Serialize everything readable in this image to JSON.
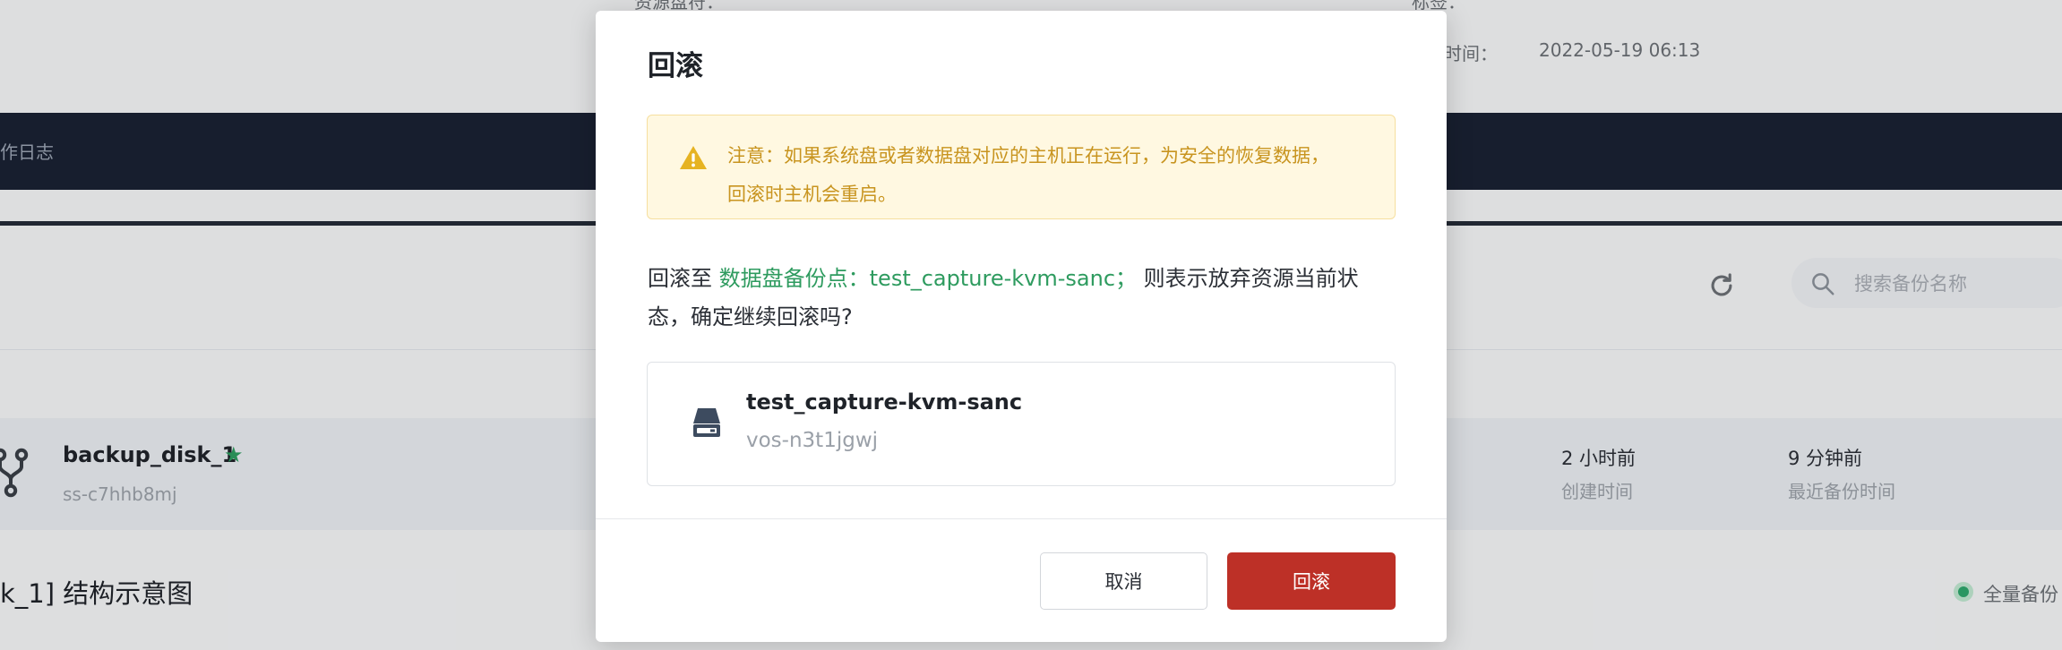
{
  "background": {
    "info_items": [
      {
        "label": "资源盘符：",
        "value": "-"
      },
      {
        "label": "标签：",
        "value": "-"
      },
      {
        "label": "时间：",
        "value": "2022-05-19 06:13"
      }
    ],
    "nav_tab": "作日志",
    "search_placeholder": "搜索备份名称",
    "row": {
      "name": "backup_disk_1",
      "star": "★",
      "id": "ss-c7hhb8mj",
      "created_value": "2 小时前",
      "created_label": "创建时间",
      "recent_value": "9 分钟前",
      "recent_label": "最近备份时间"
    },
    "section_title": "k_1] 结构示意图",
    "legend_label": "全量备份"
  },
  "modal": {
    "title": "回滚",
    "alert_text": "注意：如果系统盘或者数据盘对应的主机正在运行，为安全的恢复数据，回滚时主机会重启。",
    "message_prefix": "回滚至 ",
    "message_highlight": "数据盘备份点：test_capture-kvm-sanc；",
    "message_suffix": " 则表示放弃资源当前状态，确定继续回滚吗?",
    "card": {
      "name": "test_capture-kvm-sanc",
      "id": "vos-n3t1jgwj"
    },
    "cancel_label": "取消",
    "confirm_label": "回滚"
  },
  "colors": {
    "accent_green": "#2e9b5f",
    "danger_red": "#bd3027",
    "warning_text": "#c8941f",
    "warning_bg": "#fff8e1",
    "navbar": "#1a2233"
  },
  "icons": [
    "refresh-icon",
    "search-icon",
    "fork-icon",
    "star-icon",
    "warning-icon",
    "disk-icon",
    "full-backup-legend-dot"
  ]
}
